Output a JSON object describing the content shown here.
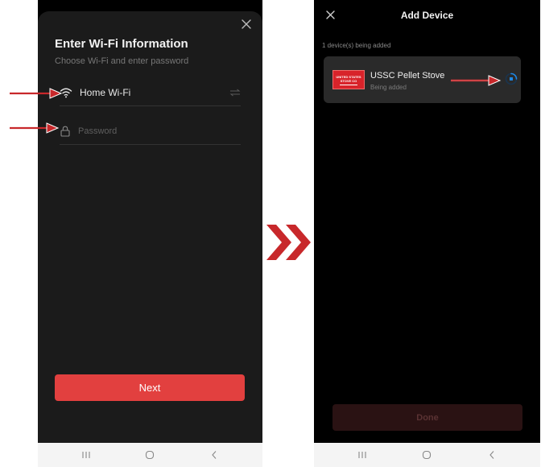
{
  "left_screen": {
    "title": "Enter Wi-Fi Information",
    "subtitle": "Choose Wi-Fi and enter password",
    "wifi_name": "Home Wi-Fi",
    "password_placeholder": "Password",
    "next_label": "Next",
    "icons": [
      "close-icon",
      "wifi-icon",
      "lock-icon",
      "switch-network-icon"
    ]
  },
  "right_screen": {
    "title": "Add Device",
    "count_text": "1 device(s) being added",
    "device": {
      "name": "USSC Pellet Stove",
      "status": "Being added",
      "logo_line1": "UNITED STATES",
      "logo_line2": "STOVE CO"
    },
    "done_label": "Done",
    "icons": [
      "close-icon",
      "loading-spinner-icon"
    ]
  },
  "colors": {
    "accent_red": "#e2403f",
    "annotation_red": "#c8282b",
    "spinner_blue": "#1e88e5",
    "sheet_bg": "#1b1b1b",
    "card_bg": "#2a2a2a"
  }
}
